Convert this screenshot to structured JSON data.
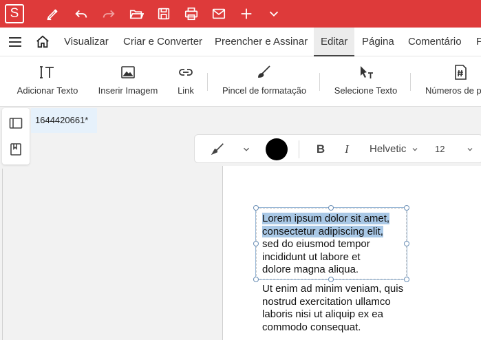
{
  "app": {
    "logo_letter": "S",
    "accent": "#de3a3a"
  },
  "quick_access": [
    "pen-icon",
    "undo-icon",
    "redo-icon",
    "open-folder-icon",
    "save-icon",
    "print-icon",
    "mail-icon",
    "add-icon",
    "chevron-down-icon"
  ],
  "menu": {
    "tabs": [
      "Visualizar",
      "Criar e Converter",
      "Preencher e Assinar",
      "Editar",
      "Página",
      "Comentário",
      "F"
    ],
    "active": "Editar"
  },
  "ribbon": {
    "add_text": "Adicionar Texto",
    "insert_image": "Inserir Imagem",
    "link": "Link",
    "format_brush": "Pincel de formatação",
    "select_text": "Selecione Texto",
    "page_numbers": "Números de p"
  },
  "document": {
    "tab_title": "1644420661*"
  },
  "format_bar": {
    "text_color": "#000000",
    "bold_label": "B",
    "italic_label": "I",
    "font_name": "Helvetic",
    "font_size": "12"
  },
  "page": {
    "paragraph1": {
      "selected_lines": [
        "Lorem ipsum dolor sit amet,",
        "consectetur adipiscing elit,"
      ],
      "lines": [
        "sed do eiusmod tempor",
        "incididunt ut labore et",
        "dolore magna aliqua."
      ]
    },
    "paragraph2": {
      "lines": [
        "Ut enim ad minim veniam, quis",
        "nostrud exercitation ullamco",
        "laboris nisi ut aliquip ex ea",
        "commodo consequat."
      ]
    }
  }
}
